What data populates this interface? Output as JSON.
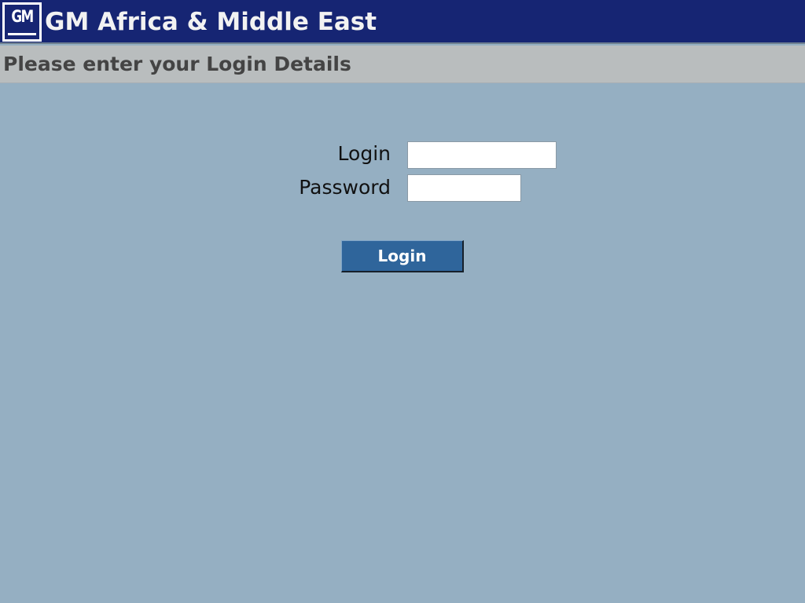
{
  "header": {
    "logo_text": "GM",
    "title": "GM Africa & Middle East"
  },
  "subheader": {
    "text": "Please enter your Login Details"
  },
  "form": {
    "login_label": "Login",
    "login_value": "",
    "password_label": "Password",
    "password_value": "",
    "submit_label": "Login"
  },
  "colors": {
    "header_bg": "#162573",
    "subheader_bg": "#b9bdbe",
    "page_bg": "#95afc2",
    "button_bg": "#2f659b"
  },
  "icons": {
    "logo": "gm-logo-icon"
  }
}
